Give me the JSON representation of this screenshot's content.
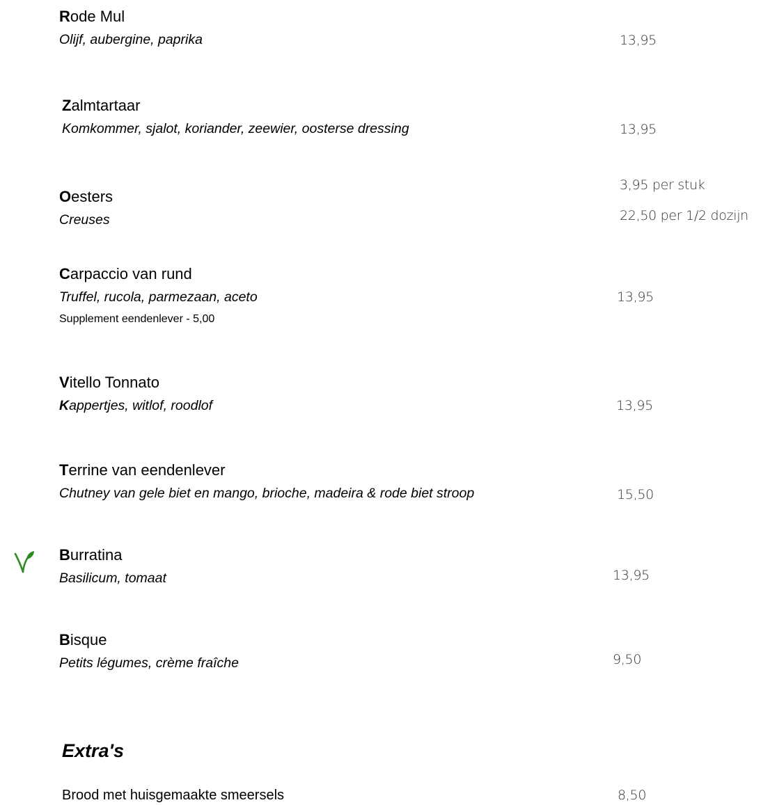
{
  "items": [
    {
      "initial": "R",
      "name_rest": "ode Mul",
      "description": "Olijf, aubergine, paprika",
      "price": "13,95"
    },
    {
      "initial": "Z",
      "name_rest": "almtartaar",
      "description": "Komkommer, sjalot, koriander, zeewier, oosterse dressing",
      "price": "13,95"
    },
    {
      "initial": "O",
      "name_rest": "esters",
      "description": "Creuses",
      "price_line1": "3,95 per stuk",
      "price_line2": "22,50 per 1/2 dozijn"
    },
    {
      "initial": "C",
      "name_rest": "arpaccio van rund",
      "description": "Truffel, rucola, parmezaan, aceto",
      "supplement": "Supplement eendenlever - 5,00",
      "price": "13,95"
    },
    {
      "initial": "V",
      "name_rest": "itello Tonnato",
      "desc_initial": "K",
      "desc_rest": "appertjes, witlof, roodlof",
      "price": "13,95"
    },
    {
      "initial": "T",
      "name_rest": "errine van eendenlever",
      "description": "Chutney van gele biet en mango, brioche, madeira & rode biet stroop",
      "price": "15,50"
    },
    {
      "initial": "B",
      "name_rest": "urratina",
      "description": "Basilicum, tomaat",
      "price": "13,95",
      "icon": "vegetarian-leaf-icon",
      "icon_color": "#2e8b22"
    },
    {
      "initial": "B",
      "name_rest": "isque",
      "description": "Petits légumes, crème fraîche",
      "price": "9,50"
    }
  ],
  "extras": {
    "heading": "Extra's",
    "items": [
      {
        "name": "Brood met huisgemaakte smeersels",
        "price": "8,50"
      }
    ]
  }
}
